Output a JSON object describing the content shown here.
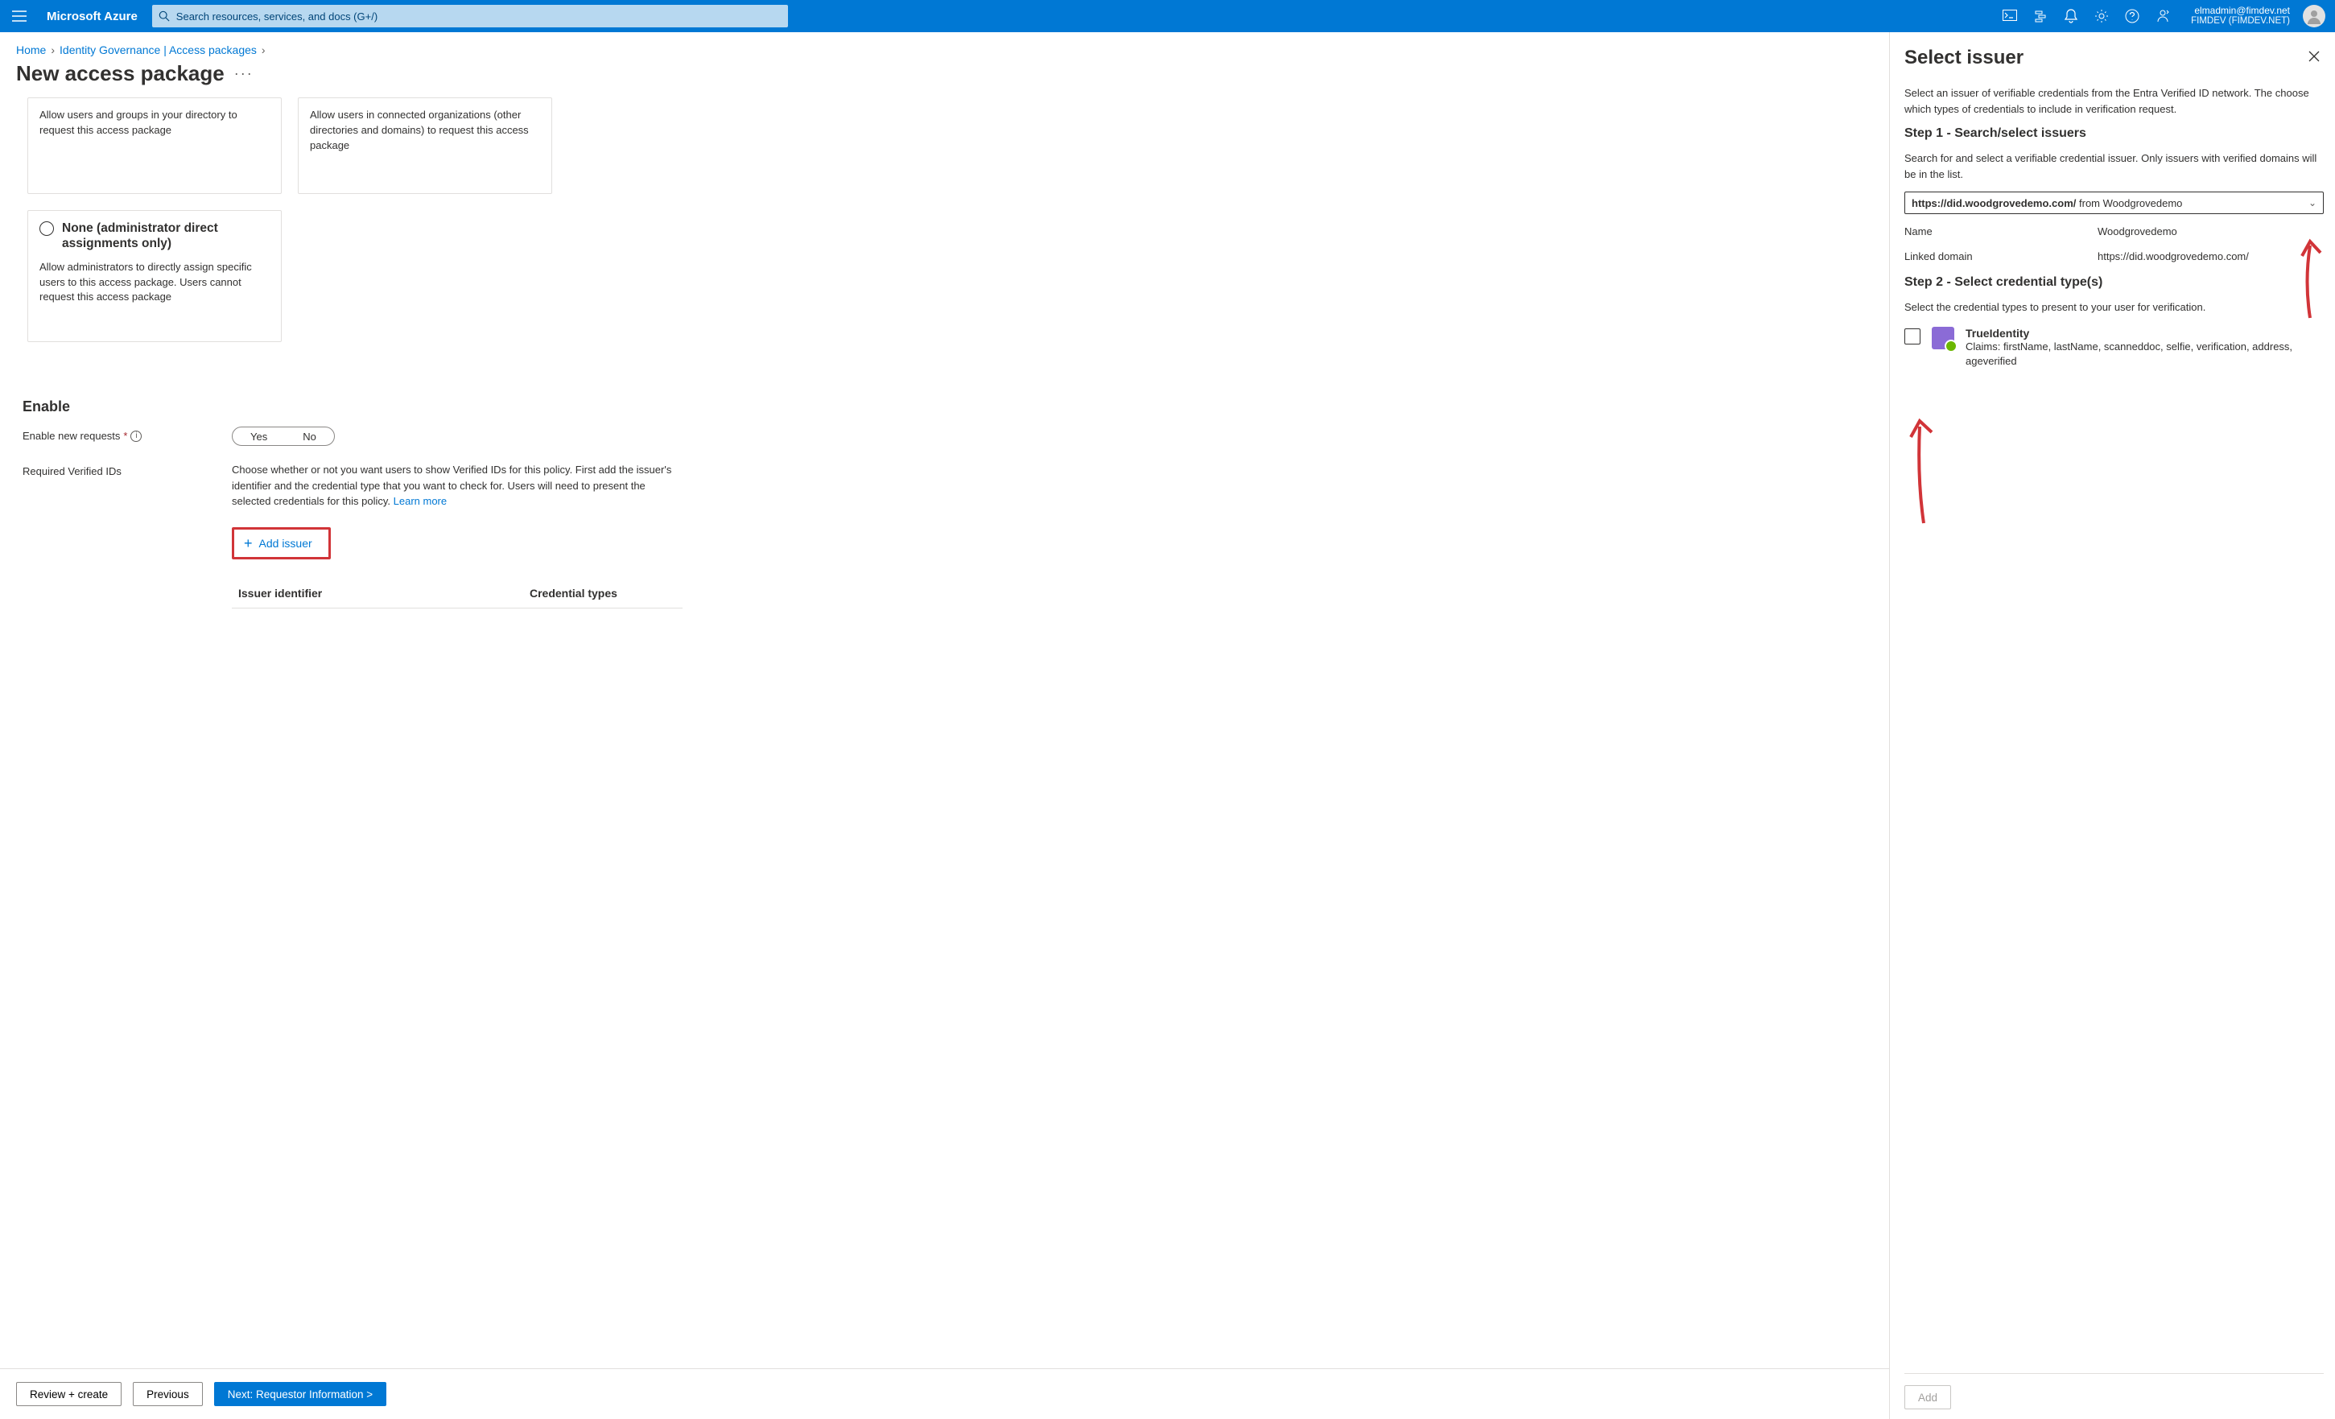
{
  "topbar": {
    "brand": "Microsoft Azure",
    "search_placeholder": "Search resources, services, and docs (G+/)",
    "account_email": "elmadmin@fimdev.net",
    "account_tenant": "FIMDEV (FIMDEV.NET)"
  },
  "breadcrumbs": {
    "items": [
      "Home",
      "Identity Governance | Access packages"
    ]
  },
  "page_title": "New access package",
  "cards": {
    "card1": "Allow users and groups in your directory to request this access package",
    "card2": "Allow users in connected organizations (other directories and domains) to request this access package",
    "card3_title": "None (administrator direct assignments only)",
    "card3_body": "Allow administrators to directly assign specific users to this access package. Users cannot request this access package"
  },
  "enable": {
    "heading": "Enable",
    "label_new_requests": "Enable new requests",
    "toggle_yes": "Yes",
    "toggle_no": "No",
    "label_required_ids": "Required Verified IDs",
    "desc_part1": "Choose whether or not you want users to show Verified IDs for this policy. First add the issuer's identifier and the credential type that you want to check for. Users will need to present the selected credentials for this policy. ",
    "learn_more": "Learn more",
    "add_issuer": "Add issuer",
    "col_issuer": "Issuer identifier",
    "col_cred": "Credential types"
  },
  "footer": {
    "review": "Review + create",
    "previous": "Previous",
    "next": "Next: Requestor Information >"
  },
  "panel": {
    "title": "Select issuer",
    "intro": "Select an issuer of verifiable credentials from the Entra Verified ID network. The choose which types of credentials to include in verification request.",
    "step1_h": "Step 1 - Search/select issuers",
    "step1_p": "Search for and select a verifiable credential issuer. Only issuers with verified domains will be in the list.",
    "combo_bold": "https://did.woodgrovedemo.com/",
    "combo_rest": " from  Woodgrovedemo",
    "name_label": "Name",
    "name_value": "Woodgrovedemo",
    "domain_label": "Linked domain",
    "domain_value": "https://did.woodgrovedemo.com/",
    "step2_h": "Step 2 - Select credential type(s)",
    "step2_p": "Select the credential types to present to your user for verification.",
    "cred_title": "TrueIdentity",
    "cred_claims": "Claims: firstName, lastName, scanneddoc, selfie, verification, address, ageverified",
    "add_btn": "Add"
  }
}
